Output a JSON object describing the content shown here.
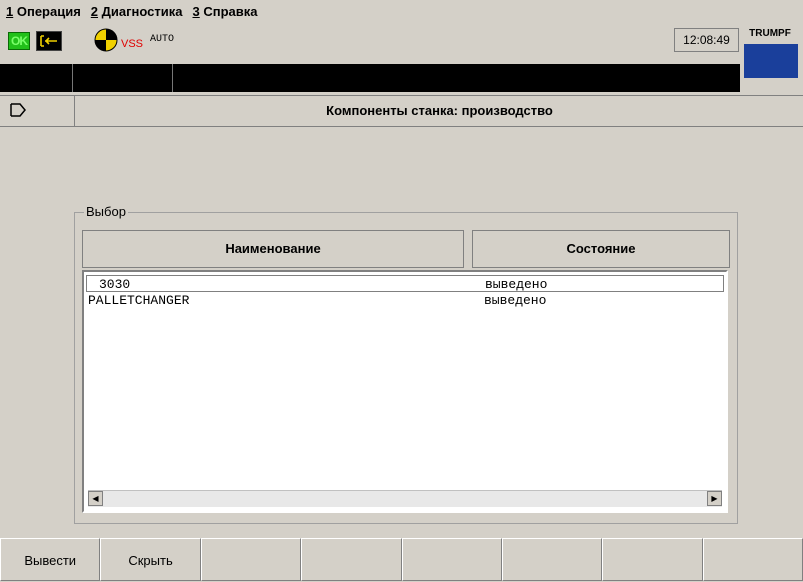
{
  "menu": {
    "items": [
      {
        "key": "1",
        "label": "Операция"
      },
      {
        "key": "2",
        "label": "Диагностика"
      },
      {
        "key": "3",
        "label": "Справка"
      }
    ]
  },
  "status": {
    "ok": "OK",
    "vss": "VSS",
    "mode": "AUTO",
    "time": "12:08:49",
    "brand": "TRUMPF"
  },
  "title": "Компоненты станка: производство",
  "selection": {
    "group_label": "Выбор",
    "col_name": "Наименование",
    "col_state": "Состояние",
    "rows": [
      {
        "name": "3030",
        "state": "выведено",
        "selected": true
      },
      {
        "name": "PALLETCHANGER",
        "state": "выведено",
        "selected": false
      }
    ]
  },
  "softkeys": [
    "Вывести",
    "Скрыть",
    "",
    "",
    "",
    "",
    "",
    ""
  ],
  "icons": {
    "ok": "ok-status-icon",
    "connection": "connection-icon",
    "vss": "vss-target-icon",
    "title": "exit-arrow-icon",
    "scroll_left": "arrow-left-icon",
    "scroll_right": "arrow-right-icon"
  },
  "colors": {
    "window_bg": "#d4d0c8",
    "ok_green": "#22c01a",
    "vss_red": "#e00000",
    "brand_blue": "#1a3f9b"
  }
}
